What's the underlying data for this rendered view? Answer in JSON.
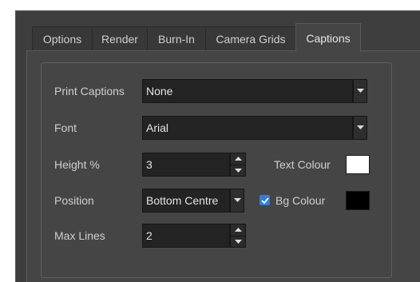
{
  "tabs": [
    {
      "label": "Options"
    },
    {
      "label": "Render"
    },
    {
      "label": "Burn-In"
    },
    {
      "label": "Camera Grids"
    },
    {
      "label": "Captions",
      "active": true
    }
  ],
  "form": {
    "print_captions": {
      "label": "Print Captions",
      "value": "None"
    },
    "font": {
      "label": "Font",
      "value": "Arial"
    },
    "height": {
      "label": "Height %",
      "value": "3"
    },
    "text_colour": {
      "label": "Text Colour",
      "color": "#ffffff"
    },
    "position": {
      "label": "Position",
      "value": "Bottom Centre"
    },
    "bg_colour": {
      "label": "Bg Colour",
      "checked": true,
      "color": "#000000"
    },
    "max_lines": {
      "label": "Max Lines",
      "value": "2"
    }
  },
  "colors": {
    "panel": "#454545",
    "field": "#232323",
    "accent": "#2f7fd6"
  },
  "icons": [
    "chevron-down-icon",
    "spin-up-icon",
    "spin-down-icon",
    "checkmark-icon"
  ]
}
